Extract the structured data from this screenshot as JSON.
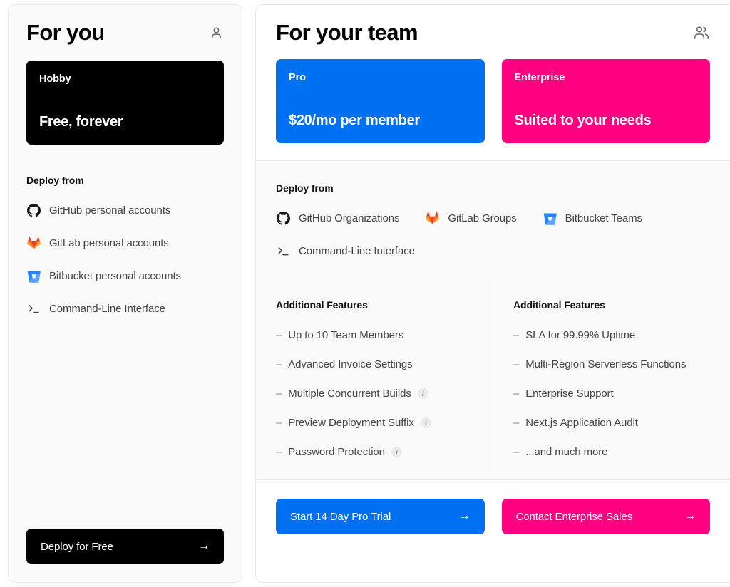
{
  "colors": {
    "blue": "#0070F3",
    "pink": "#FF0080",
    "black": "#000000",
    "panel_bg": "#FAFAFA",
    "border": "#EAEAEA"
  },
  "left_panel": {
    "title": "For you",
    "icon": "user-icon",
    "plan": {
      "name": "Hobby",
      "price": "Free, forever",
      "color": "#000000"
    },
    "deploy_heading": "Deploy from",
    "sources": [
      {
        "icon": "github-icon",
        "label": "GitHub personal accounts"
      },
      {
        "icon": "gitlab-icon",
        "label": "GitLab personal accounts"
      },
      {
        "icon": "bitbucket-icon",
        "label": "Bitbucket personal accounts"
      }
    ],
    "cli": {
      "icon": "terminal-icon",
      "label": "Command-Line Interface"
    },
    "cta": {
      "label": "Deploy for Free",
      "arrow": "→"
    }
  },
  "right_panel": {
    "title": "For your team",
    "icon": "users-icon",
    "plans": [
      {
        "name": "Pro",
        "price": "$20/mo per member",
        "color": "#0070F3"
      },
      {
        "name": "Enterprise",
        "price": "Suited to your needs",
        "color": "#FF0080"
      }
    ],
    "deploy_heading": "Deploy from",
    "sources": [
      {
        "icon": "github-icon",
        "label": "GitHub Organizations"
      },
      {
        "icon": "gitlab-icon",
        "label": "GitLab Groups"
      },
      {
        "icon": "bitbucket-icon",
        "label": "Bitbucket Teams"
      }
    ],
    "cli": {
      "icon": "terminal-icon",
      "label": "Command-Line Interface"
    },
    "feature_columns": [
      {
        "heading": "Additional Features",
        "items": [
          {
            "label": "Up to 10 Team Members",
            "info": false
          },
          {
            "label": "Advanced Invoice Settings",
            "info": false
          },
          {
            "label": "Multiple Concurrent Builds",
            "info": true
          },
          {
            "label": "Preview Deployment Suffix",
            "info": true
          },
          {
            "label": "Password Protection",
            "info": true
          }
        ]
      },
      {
        "heading": "Additional Features",
        "items": [
          {
            "label": "SLA for 99.99% Uptime",
            "info": false
          },
          {
            "label": "Multi-Region Serverless Functions",
            "info": false
          },
          {
            "label": "Enterprise Support",
            "info": false
          },
          {
            "label": "Next.js Application Audit",
            "info": false
          },
          {
            "label": "...and much more",
            "info": false
          }
        ]
      }
    ],
    "ctas": [
      {
        "label": "Start 14 Day Pro Trial",
        "arrow": "→",
        "color": "#0070F3"
      },
      {
        "label": "Contact Enterprise Sales",
        "arrow": "→",
        "color": "#FF0080"
      }
    ]
  },
  "info_glyph": "i"
}
